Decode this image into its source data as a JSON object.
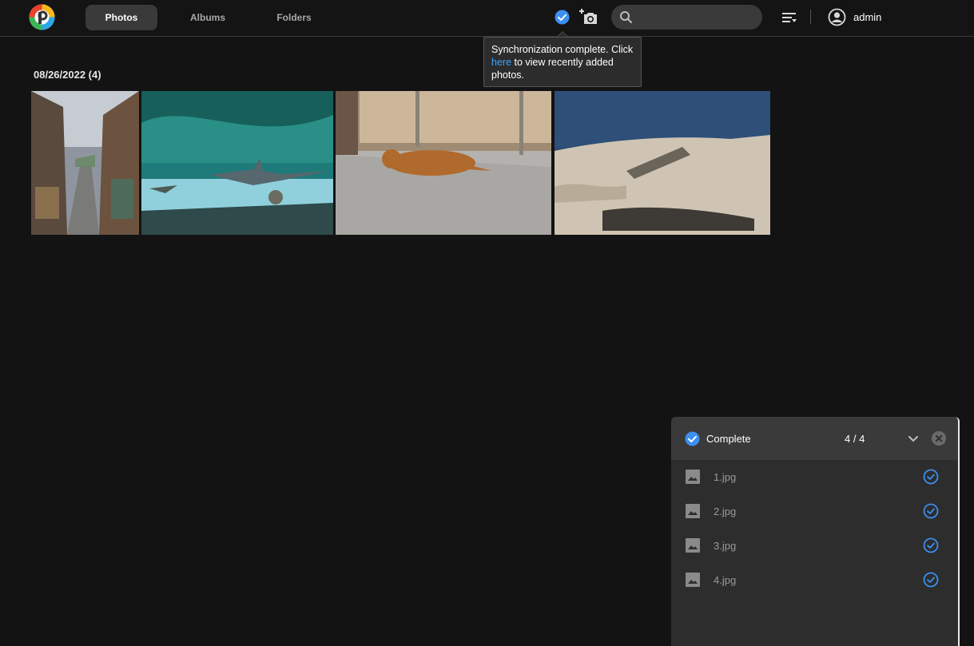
{
  "header": {
    "tabs": [
      {
        "label": "Photos",
        "active": true
      },
      {
        "label": "Albums",
        "active": false
      },
      {
        "label": "Folders",
        "active": false
      }
    ],
    "search": {
      "value": "",
      "placeholder": ""
    },
    "user": "admin"
  },
  "tooltip": {
    "text_before": "Synchronization complete. Click ",
    "link": "here",
    "text_after": " to view recently added photos."
  },
  "gallery": {
    "date_header": "08/26/2022 (4)"
  },
  "upload": {
    "status": "Complete",
    "count": "4 / 4",
    "files": [
      {
        "name": "1.jpg"
      },
      {
        "name": "2.jpg"
      },
      {
        "name": "3.jpg"
      },
      {
        "name": "4.jpg"
      }
    ]
  },
  "colors": {
    "accent": "#3b8ff0",
    "link": "#3ba3ff",
    "background": "#131313"
  }
}
